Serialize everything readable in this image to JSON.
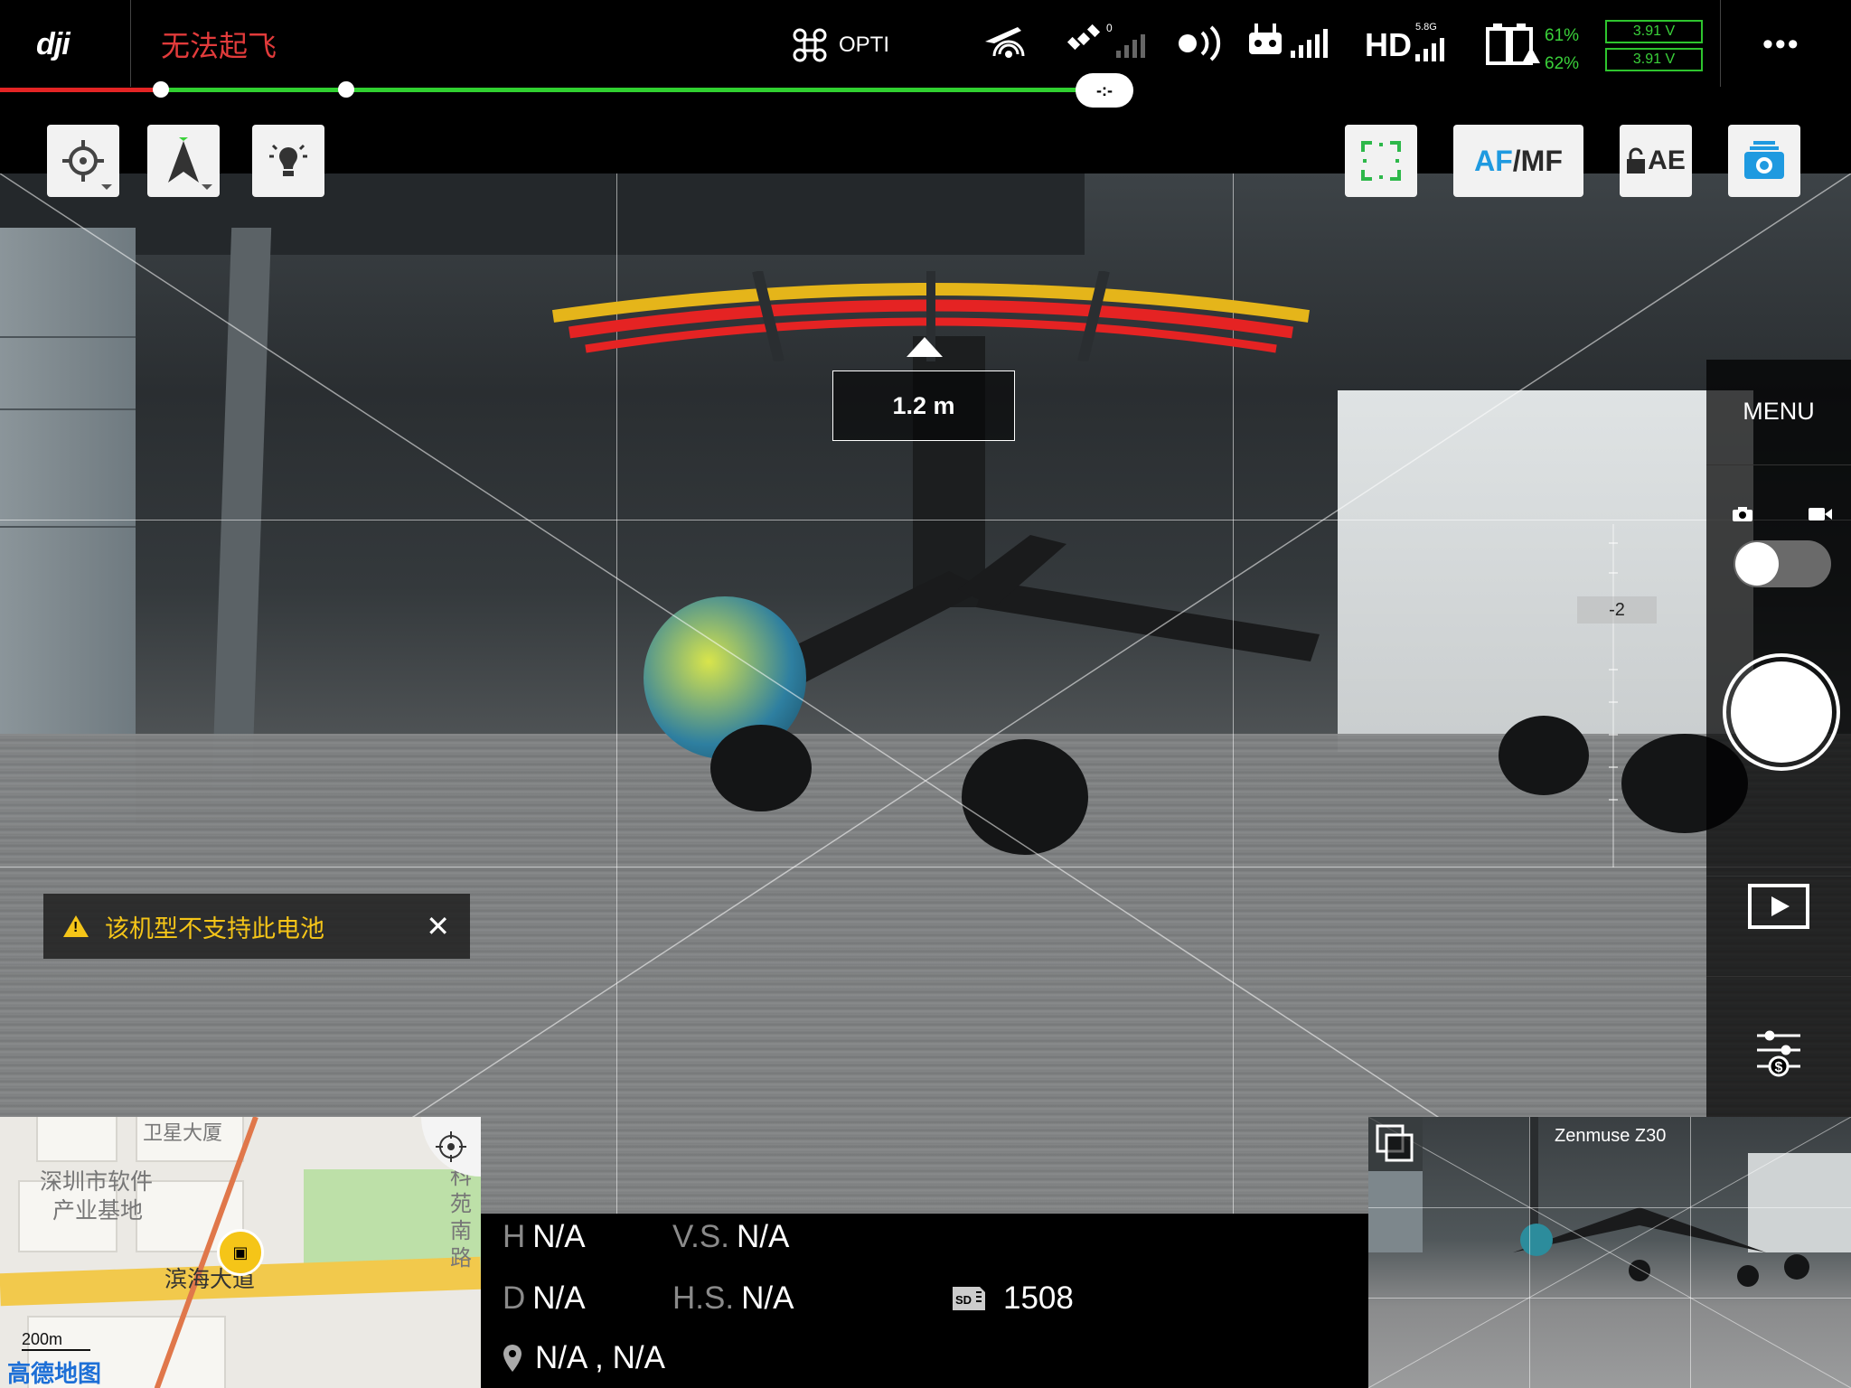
{
  "app": {
    "logo": "dji"
  },
  "status": {
    "text": "无法起飞",
    "color": "#e23b3b"
  },
  "aircraft": {
    "mode": "OPTI"
  },
  "signal": {
    "gps_count": "0",
    "hd_band": "5.8G",
    "hd_label": "HD"
  },
  "battery": {
    "percent_1": "61%",
    "percent_2": "62%",
    "voltage_1": "3.91 V",
    "voltage_2": "3.91 V"
  },
  "track": {
    "end_label": "-:-"
  },
  "toolbar": {
    "af_label": "AF",
    "mf_label": "/MF",
    "ae_label": "AE"
  },
  "obstacle": {
    "distance": "1.2 m"
  },
  "right_panel": {
    "menu_label": "MENU",
    "ev_value": "-2"
  },
  "toast": {
    "message": "该机型不支持此电池"
  },
  "map": {
    "labels": [
      "卫星大厦",
      "深圳市软件",
      "产业基地",
      "滨海大道",
      "科苑南路"
    ],
    "scale": "200m",
    "brand": "高德地图"
  },
  "telemetry": {
    "h_key": "H",
    "h_val": "N/A",
    "vs_key": "V.S.",
    "vs_val": "N/A",
    "d_key": "D",
    "d_val": "N/A",
    "hs_key": "H.S.",
    "hs_val": "N/A",
    "sd_count": "1508",
    "location": "N/A , N/A"
  },
  "pip": {
    "camera_name": "Zenmuse Z30"
  },
  "colors": {
    "accent_green": "#30d030",
    "accent_red": "#e42424",
    "af_blue": "#1f9ae0",
    "warn_yellow": "#f5c518"
  }
}
